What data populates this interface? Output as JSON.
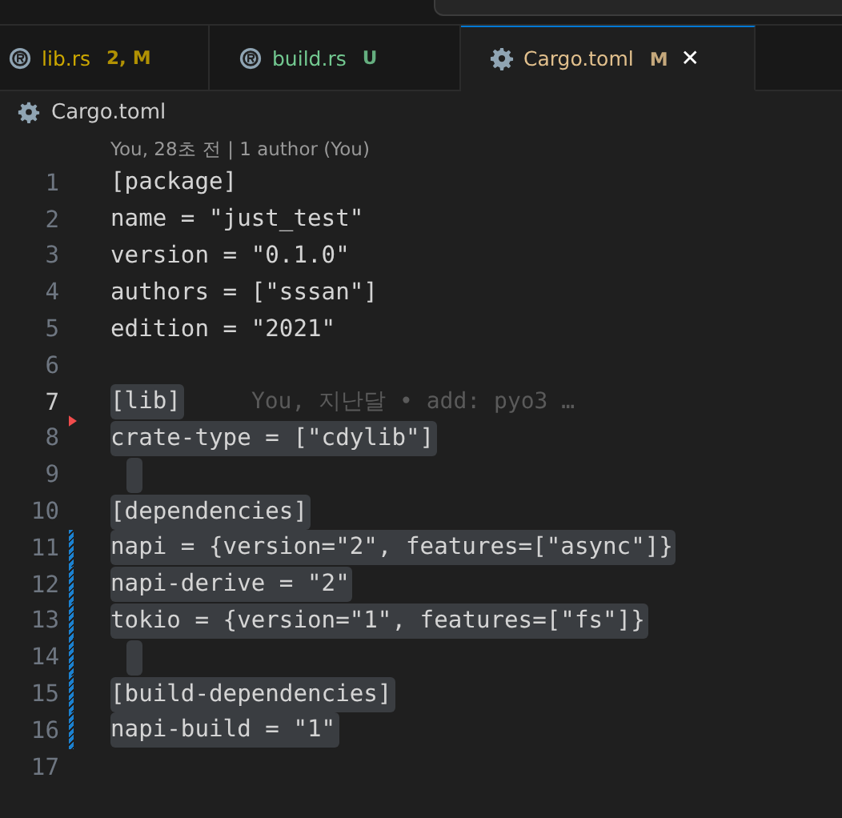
{
  "tabs": [
    {
      "label": "lib.rs",
      "badge": "2, M",
      "kind": "rust",
      "color": "#cca700",
      "selected": false,
      "closable": false
    },
    {
      "label": "build.rs",
      "badge": "U",
      "kind": "rust",
      "color": "#73c991",
      "selected": false,
      "closable": false
    },
    {
      "label": "Cargo.toml",
      "badge": "M",
      "kind": "gear",
      "color": "#e2c08d",
      "selected": true,
      "closable": true,
      "close_glyph": "✕"
    }
  ],
  "breadcrumb": {
    "label": "Cargo.toml"
  },
  "codelens": "You, 28초 전 | 1 author (You)",
  "lines": [
    {
      "number": "1",
      "text": "[package]",
      "selected": false,
      "current": false,
      "deleted": false,
      "modified": false
    },
    {
      "number": "2",
      "text": "name = \"just_test\"",
      "selected": false,
      "current": false,
      "deleted": false,
      "modified": false
    },
    {
      "number": "3",
      "text": "version = \"0.1.0\"",
      "selected": false,
      "current": false,
      "deleted": false,
      "modified": false
    },
    {
      "number": "4",
      "text": "authors = [\"sssan\"]",
      "selected": false,
      "current": false,
      "deleted": false,
      "modified": false
    },
    {
      "number": "5",
      "text": "edition = \"2021\"",
      "selected": false,
      "current": false,
      "deleted": false,
      "modified": false
    },
    {
      "number": "6",
      "selected": false,
      "current": false,
      "deleted": false,
      "modified": false
    },
    {
      "number": "7",
      "text": "[lib]",
      "selected": true,
      "current": true,
      "deleted": false,
      "modified": false,
      "blame": "You, 지난달 • add: pyo3 …"
    },
    {
      "number": "8",
      "text": "crate-type = [\"cdylib\"]",
      "selected": true,
      "current": false,
      "deleted": true,
      "modified": false
    },
    {
      "number": "9",
      "selected": true,
      "current": false,
      "deleted": false,
      "modified": false
    },
    {
      "number": "10",
      "text": "[dependencies]",
      "selected": true,
      "current": false,
      "deleted": false,
      "modified": false
    },
    {
      "number": "11",
      "text": "napi = {version=\"2\", features=[\"async\"]}",
      "selected": true,
      "current": false,
      "deleted": false,
      "modified": true
    },
    {
      "number": "12",
      "text": "napi-derive = \"2\"",
      "selected": true,
      "current": false,
      "deleted": false,
      "modified": true
    },
    {
      "number": "13",
      "text": "tokio = {version=\"1\", features=[\"fs\"]}",
      "selected": true,
      "current": false,
      "deleted": false,
      "modified": true
    },
    {
      "number": "14",
      "selected": true,
      "current": false,
      "deleted": false,
      "modified": true
    },
    {
      "number": "15",
      "text": "[build-dependencies]",
      "selected": true,
      "current": false,
      "deleted": false,
      "modified": true
    },
    {
      "number": "16",
      "text": "napi-build = \"1\"",
      "selected": true,
      "current": false,
      "deleted": false,
      "modified": true
    },
    {
      "number": "17",
      "selected": false,
      "current": false,
      "deleted": false,
      "modified": false
    }
  ]
}
